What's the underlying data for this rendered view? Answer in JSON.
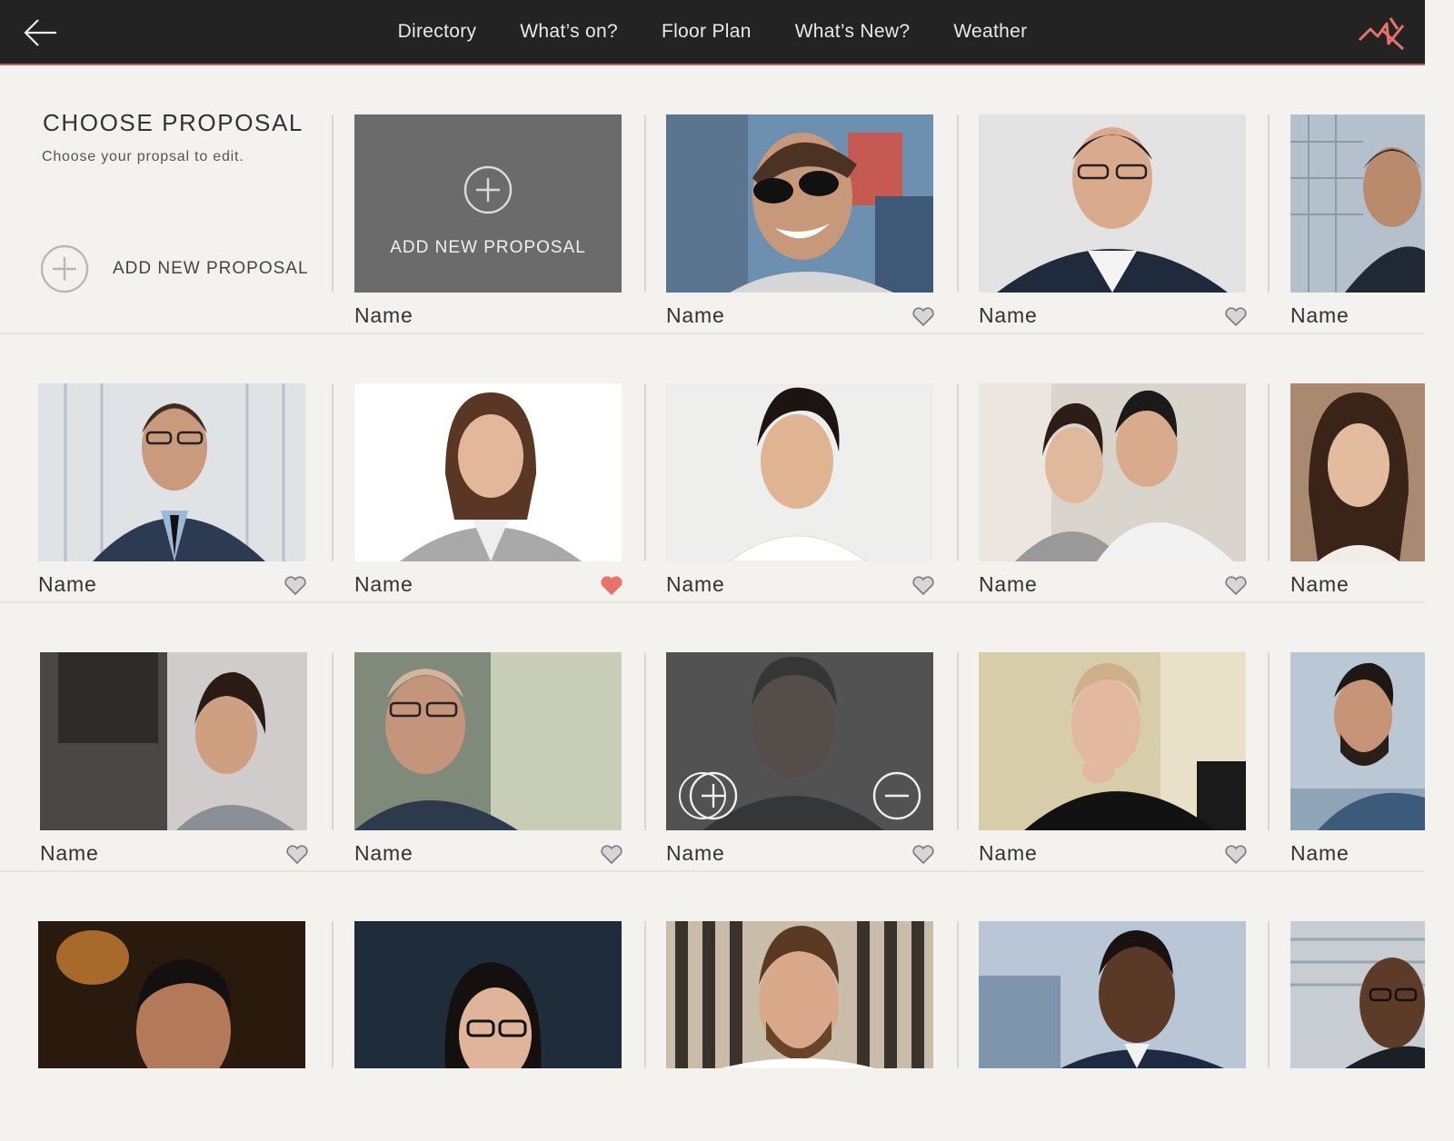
{
  "nav": {
    "items": [
      "Directory",
      "What’s on?",
      "Floor Plan",
      "What’s New?",
      "Weather"
    ]
  },
  "colors": {
    "topbar": "#232323",
    "accent": "#e8716a",
    "heart_active": "#e8716a",
    "heart_inactive": "#7a7a7a",
    "background": "#f3f2ef"
  },
  "header": {
    "title": "CHOOSE PROPOSAL",
    "subtitle": "Choose your propsal to edit.",
    "add_label": "ADD NEW PROPOSAL",
    "tile_label": "ADD NEW PROPOSAL",
    "tile_name": "Name"
  },
  "profiles": {
    "r0c2": {
      "name": "Name",
      "liked": false
    },
    "r0c3": {
      "name": "Name",
      "liked": false
    },
    "r0c4": {
      "name": "Name"
    },
    "r1c0": {
      "name": "Name",
      "liked": false
    },
    "r1c1": {
      "name": "Name",
      "liked": true
    },
    "r1c2": {
      "name": "Name",
      "liked": false
    },
    "r1c3": {
      "name": "Name",
      "liked": false
    },
    "r1c4": {
      "name": "Name"
    },
    "r2c0": {
      "name": "Name",
      "liked": false
    },
    "r2c1": {
      "name": "Name",
      "liked": false
    },
    "r2c2": {
      "name": "Name",
      "liked": false
    },
    "r2c3": {
      "name": "Name",
      "liked": false
    },
    "r2c4": {
      "name": "Name"
    }
  },
  "icons": {
    "back": "arrow-left-icon",
    "logo": "brand-logo-icon",
    "heart": "heart-icon",
    "add": "plus-circle-icon",
    "remove": "minus-circle-icon"
  }
}
